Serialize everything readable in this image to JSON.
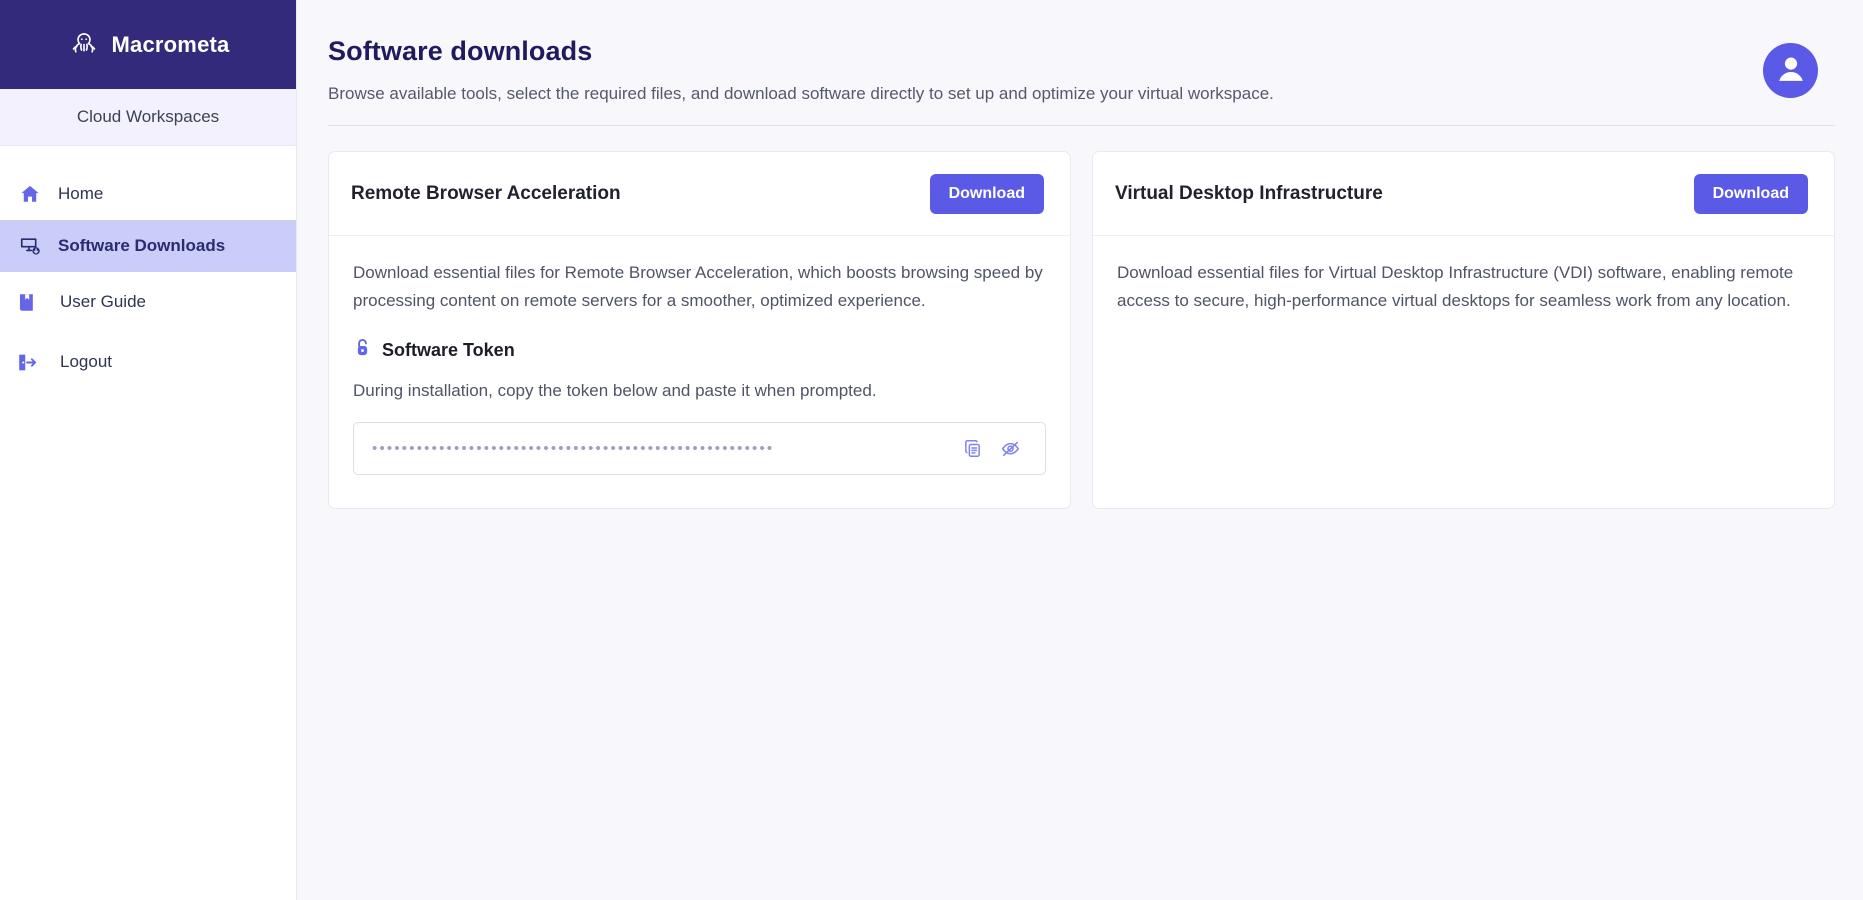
{
  "brand": {
    "name": "Macrometa",
    "logo_icon": "octopus-logo-icon",
    "bg_color": "#332A7C"
  },
  "sidebar": {
    "workspace_label": "Cloud Workspaces",
    "items": [
      {
        "label": "Home",
        "icon": "home-icon",
        "active": false
      },
      {
        "label": "Software Downloads",
        "icon": "monitor-download-icon",
        "active": true
      }
    ],
    "bottom_items": [
      {
        "label": "User Guide",
        "icon": "book-icon"
      },
      {
        "label": "Logout",
        "icon": "logout-icon"
      }
    ],
    "active_bg": "#C9CDF7"
  },
  "header": {
    "title": "Software downloads",
    "subtitle": "Browse available tools, select the required files, and download software directly to set up and optimize your virtual workspace.",
    "avatar_icon": "user-avatar-icon",
    "avatar_color": "#5A5AE6"
  },
  "cards": [
    {
      "title": "Remote Browser Acceleration",
      "download_label": "Download",
      "description": "Download essential files for Remote Browser Acceleration, which boosts browsing speed by processing content on remote servers for a smoother, optimized experience.",
      "token": {
        "section_label": "Software Token",
        "lock_icon": "unlocked-padlock-icon",
        "hint": "During installation, copy the token below and paste it when prompted.",
        "masked_value": "••••••••••••••••••••••••••••••••••••••••••••••••••••••",
        "copy_icon": "copy-icon",
        "reveal_icon": "eye-off-icon"
      }
    },
    {
      "title": "Virtual Desktop Infrastructure",
      "download_label": "Download",
      "description": "Download essential files for Virtual Desktop Infrastructure (VDI) software, enabling remote access to secure, high-performance virtual desktops for seamless work from any location.",
      "token": null
    }
  ],
  "theme": {
    "accent": "#5A5AE6",
    "brand_dark": "#332A7C",
    "page_bg": "#F8F7FC",
    "card_bg": "#FFFFFF"
  }
}
